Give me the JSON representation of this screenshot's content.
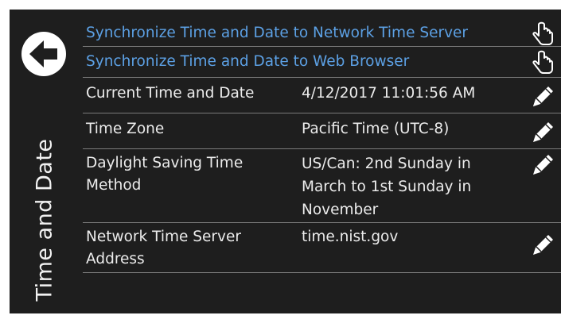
{
  "page": {
    "title": "Time and Date"
  },
  "sync": {
    "network_label": "Synchronize Time and Date to Network Time Server",
    "browser_label": "Synchronize Time and Date to Web Browser"
  },
  "settings": [
    {
      "label": "Current Time and Date",
      "value": "4/12/2017 11:01:56 AM"
    },
    {
      "label": "Time Zone",
      "value": "Pacific Time (UTC-8)"
    },
    {
      "label": "Daylight Saving Time Method",
      "value": "US/Can: 2nd Sunday in March to 1st Sunday in November"
    },
    {
      "label": "Network Time Server Address",
      "value": "time.nist.gov"
    }
  ],
  "icons": {
    "back": "back-arrow-icon",
    "tap": "hand-pointer-icon",
    "edit": "pencil-icon"
  },
  "colors": {
    "background": "#1e1e1e",
    "link": "#5ca0e4",
    "text": "#ececec",
    "divider": "#7a7a7a"
  }
}
